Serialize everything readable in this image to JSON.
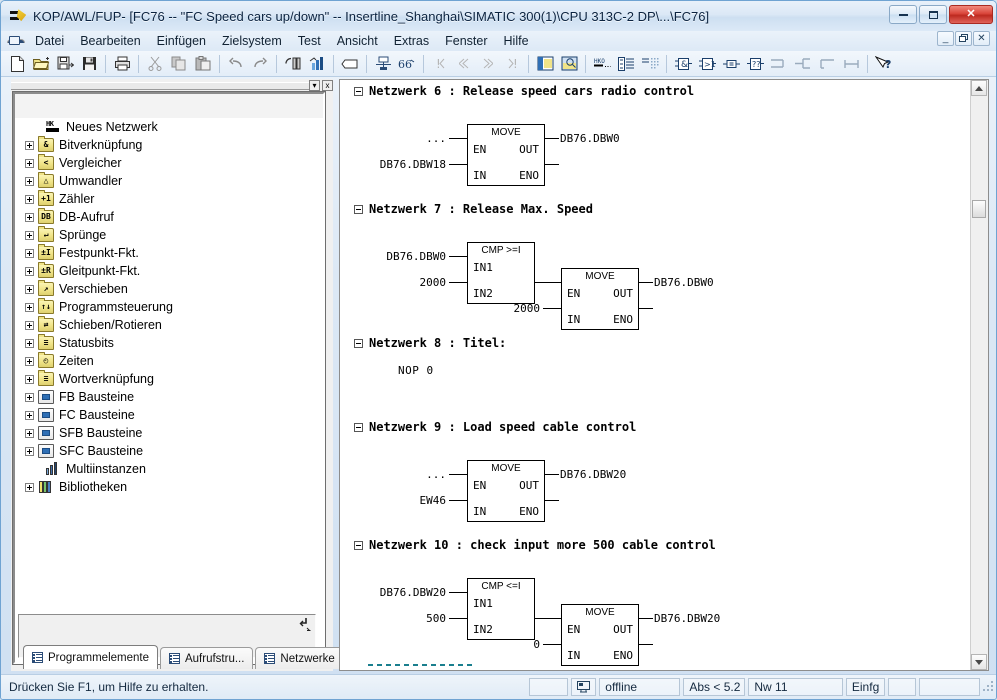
{
  "window": {
    "app_title": "KOP/AWL/FUP",
    "doc_title": " - [FC76 -- \"FC Speed cars up/down\" -- Insertline_Shanghai\\SIMATIC 300(1)\\CPU 313C-2 DP\\...\\FC76]",
    "app_icon": "kop-awl-fup-icon",
    "minimize_label": "minimize",
    "maximize_label": "maximize",
    "close_label": "✕",
    "mdi": {
      "minimize": "_",
      "restore": "❐",
      "close": "✕"
    }
  },
  "menu": {
    "system_icon": "system-menu-icon",
    "items": [
      {
        "label": "Datei"
      },
      {
        "label": "Bearbeiten"
      },
      {
        "label": "Einfügen"
      },
      {
        "label": "Zielsystem"
      },
      {
        "label": "Test"
      },
      {
        "label": "Ansicht"
      },
      {
        "label": "Extras"
      },
      {
        "label": "Fenster"
      },
      {
        "label": "Hilfe"
      }
    ]
  },
  "toolbar": {
    "buttons": [
      {
        "name": "new-icon",
        "tip": "Neu"
      },
      {
        "name": "open-icon",
        "tip": "Öffnen"
      },
      {
        "name": "save-as-icon",
        "tip": "Speichern unter"
      },
      {
        "name": "save-icon",
        "tip": "Speichern"
      },
      {
        "name": "print-icon",
        "tip": "Drucken"
      },
      {
        "name": "cut-icon",
        "tip": "Ausschneiden"
      },
      {
        "name": "copy-icon",
        "tip": "Kopieren"
      },
      {
        "name": "paste-icon",
        "tip": "Einfügen"
      },
      {
        "name": "undo-icon",
        "tip": "Rückgängig"
      },
      {
        "name": "redo-icon",
        "tip": "Wiederherstellen"
      },
      {
        "name": "download-icon",
        "tip": "Laden"
      },
      {
        "name": "monitor-icon",
        "tip": "Beobachten"
      },
      {
        "name": "symbol-table-icon",
        "tip": "Symboltabelle"
      },
      {
        "name": "symbolic-representation-icon",
        "tip": "Symbolische Darstellung"
      },
      {
        "name": "zoom-icon",
        "tip": "Vergrößern"
      },
      {
        "name": "first-error-icon",
        "tip": "Erster Fehler"
      },
      {
        "name": "prev-error-icon",
        "tip": "Vorheriger Fehler"
      },
      {
        "name": "next-error-icon",
        "tip": "Nächster Fehler"
      },
      {
        "name": "last-error-icon",
        "tip": "Letzter Fehler"
      },
      {
        "name": "split-view-icon",
        "tip": "Ansicht teilen"
      },
      {
        "name": "overview-icon",
        "tip": "Übersicht"
      },
      {
        "name": "network-title-icon",
        "tip": "Netzwerktitel"
      },
      {
        "name": "declaration-icon",
        "tip": "Deklaration"
      },
      {
        "name": "comment-icon",
        "tip": "Kommentar"
      },
      {
        "name": "and-box-icon",
        "tip": "UND-Box"
      },
      {
        "name": "or-box-icon",
        "tip": "ODER-Box"
      },
      {
        "name": "assign-box-icon",
        "tip": "Zuweisung"
      },
      {
        "name": "empty-box-icon",
        "tip": "Leere Box"
      },
      {
        "name": "branch-open-icon",
        "tip": "Zweig öffnen"
      },
      {
        "name": "branch-close-icon",
        "tip": "Zweig schließen"
      },
      {
        "name": "branch-up-icon",
        "tip": "Zweig nach oben"
      },
      {
        "name": "connect-icon",
        "tip": "Verbinden"
      },
      {
        "name": "help-pointer-icon",
        "tip": "Direkthilfe"
      }
    ]
  },
  "sidebar": {
    "panel_close_label": "x",
    "panel_dropdown_label": "▾",
    "footer_corner_icon": "goto-icon",
    "tree": [
      {
        "label": "Neues Netzwerk",
        "icon": "new-network-icon",
        "expandable": false
      },
      {
        "label": "Bitverknüpfung",
        "icon": "bit-logic-folder-icon",
        "expandable": true,
        "sym": "&"
      },
      {
        "label": "Vergleicher",
        "icon": "comparator-folder-icon",
        "expandable": true,
        "sym": "<"
      },
      {
        "label": "Umwandler",
        "icon": "converter-folder-icon",
        "expandable": true,
        "sym": "△"
      },
      {
        "label": "Zähler",
        "icon": "counter-folder-icon",
        "expandable": true,
        "sym": "+1"
      },
      {
        "label": "DB-Aufruf",
        "icon": "db-call-folder-icon",
        "expandable": true,
        "sym": "DB"
      },
      {
        "label": "Sprünge",
        "icon": "jumps-folder-icon",
        "expandable": true,
        "sym": "↵"
      },
      {
        "label": "Festpunkt-Fkt.",
        "icon": "integer-math-folder-icon",
        "expandable": true,
        "sym": "±I"
      },
      {
        "label": "Gleitpunkt-Fkt.",
        "icon": "float-math-folder-icon",
        "expandable": true,
        "sym": "±R"
      },
      {
        "label": "Verschieben",
        "icon": "move-folder-icon",
        "expandable": true,
        "sym": "↗"
      },
      {
        "label": "Programmsteuerung",
        "icon": "program-control-folder-icon",
        "expandable": true,
        "sym": "↑↓"
      },
      {
        "label": "Schieben/Rotieren",
        "icon": "shift-rotate-folder-icon",
        "expandable": true,
        "sym": "⇄"
      },
      {
        "label": "Statusbits",
        "icon": "status-bits-folder-icon",
        "expandable": true,
        "sym": "≡"
      },
      {
        "label": "Zeiten",
        "icon": "timers-folder-icon",
        "expandable": true,
        "sym": "◴"
      },
      {
        "label": "Wortverknüpfung",
        "icon": "word-logic-folder-icon",
        "expandable": true,
        "sym": "≡"
      },
      {
        "label": "FB Bausteine",
        "icon": "fb-block-icon",
        "expandable": true
      },
      {
        "label": "FC Bausteine",
        "icon": "fc-block-icon",
        "expandable": true
      },
      {
        "label": "SFB Bausteine",
        "icon": "sfb-block-icon",
        "expandable": true
      },
      {
        "label": "SFC Bausteine",
        "icon": "sfc-block-icon",
        "expandable": true
      },
      {
        "label": "Multiinstanzen",
        "icon": "multi-instance-icon",
        "expandable": false
      },
      {
        "label": "Bibliotheken",
        "icon": "libraries-icon",
        "expandable": true
      }
    ],
    "tabs": [
      {
        "label": "Programmelemente",
        "icon": "program-elements-icon",
        "active": true
      },
      {
        "label": "Aufrufstru...",
        "icon": "call-structure-icon",
        "active": false
      },
      {
        "label": "Netzwerke",
        "icon": "networks-icon",
        "active": false
      }
    ]
  },
  "editor": {
    "networks": [
      {
        "collapse_icon": "collapse-icon",
        "header": "Netzwerk  6 : Release speed cars radio control",
        "blocks": [
          {
            "type": "MOVE",
            "label": "MOVE",
            "pins": {
              "en": "EN",
              "out": "OUT",
              "in": "IN",
              "eno": "ENO"
            },
            "left_top": "...",
            "left_bottom": "DB76.DBW18",
            "right_top": "DB76.DBW0"
          }
        ]
      },
      {
        "collapse_icon": "collapse-icon",
        "header": "Netzwerk  7 : Release Max. Speed",
        "blocks": [
          {
            "type": "CMP",
            "label": "CMP >=I",
            "pins": {
              "in1": "IN1",
              "in2": "IN2"
            },
            "left_top": "DB76.DBW0",
            "left_bottom": "2000"
          },
          {
            "type": "MOVE",
            "label": "MOVE",
            "pins": {
              "en": "EN",
              "out": "OUT",
              "in": "IN",
              "eno": "ENO"
            },
            "left_bottom": "2000",
            "right_top": "DB76.DBW0"
          }
        ]
      },
      {
        "collapse_icon": "collapse-icon",
        "header": "Netzwerk  8 : Titel:",
        "nop": "NOP   0",
        "blocks": []
      },
      {
        "collapse_icon": "collapse-icon",
        "header": "Netzwerk  9 : Load speed cable control",
        "blocks": [
          {
            "type": "MOVE",
            "label": "MOVE",
            "pins": {
              "en": "EN",
              "out": "OUT",
              "in": "IN",
              "eno": "ENO"
            },
            "left_top": "...",
            "left_bottom": "EW46",
            "right_top": "DB76.DBW20"
          }
        ]
      },
      {
        "collapse_icon": "collapse-icon",
        "header": "Netzwerk 10 : check input more 500 cable control",
        "blocks": [
          {
            "type": "CMP",
            "label": "CMP <=I",
            "pins": {
              "in1": "IN1",
              "in2": "IN2"
            },
            "left_top": "DB76.DBW20",
            "left_bottom": "500"
          },
          {
            "type": "MOVE",
            "label": "MOVE",
            "pins": {
              "en": "EN",
              "out": "OUT",
              "in": "IN",
              "eno": "ENO"
            },
            "left_bottom": "0",
            "right_top": "DB76.DBW20"
          }
        ]
      }
    ],
    "scrollbar": {
      "up_icon": "scroll-up-icon",
      "down_icon": "scroll-down-icon"
    }
  },
  "statusbar": {
    "message": "Drücken Sie F1, um Hilfe zu erhalten.",
    "connection_icon": "plc-connection-icon",
    "mode": "offline",
    "absolute": "Abs < 5.2",
    "network": "Nw 11",
    "insert_mode": "Einfg",
    "extra1": "",
    "extra2": ""
  },
  "colors": {
    "accent": "#2f6fb5",
    "title_text": "#0b2340",
    "close_red": "#d9453a",
    "cursor_teal": "#1a7f8e",
    "folder_yellow": "#f0e488"
  }
}
